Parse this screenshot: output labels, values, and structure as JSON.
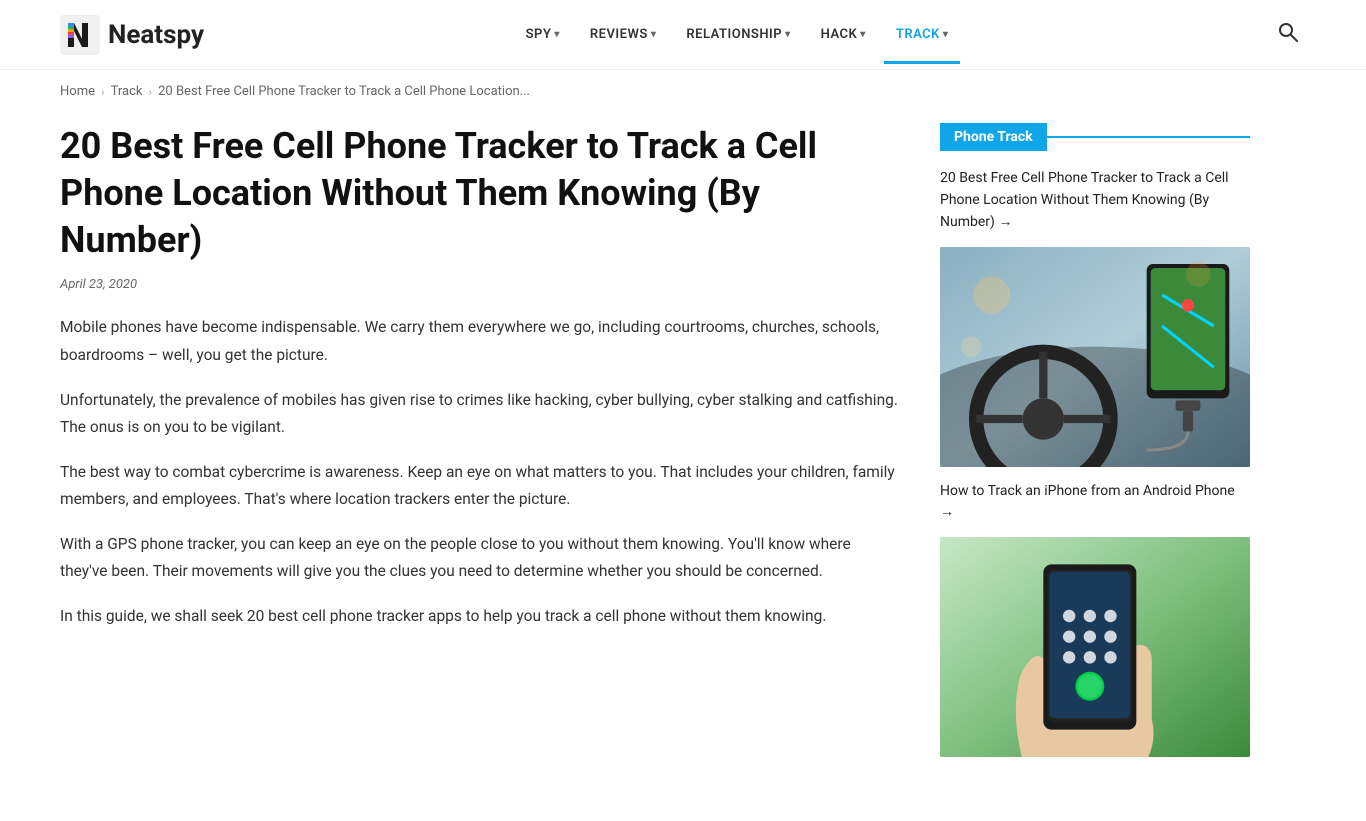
{
  "header": {
    "logo_text": "Neatspy",
    "search_label": "Search"
  },
  "nav": {
    "items": [
      {
        "label": "SPY",
        "has_dropdown": true,
        "active": false
      },
      {
        "label": "REVIEWS",
        "has_dropdown": true,
        "active": false
      },
      {
        "label": "RELATIONSHIP",
        "has_dropdown": true,
        "active": false
      },
      {
        "label": "HACK",
        "has_dropdown": true,
        "active": false
      },
      {
        "label": "TRACK",
        "has_dropdown": true,
        "active": true
      }
    ]
  },
  "breadcrumb": {
    "home": "Home",
    "track": "Track",
    "current": "20 Best Free Cell Phone Tracker to Track a Cell Phone Location..."
  },
  "article": {
    "title": "20 Best Free Cell Phone Tracker to Track a Cell Phone Location Without Them Knowing (By Number)",
    "date": "April 23, 2020",
    "paragraphs": [
      "Mobile phones have become indispensable. We carry them everywhere we go, including courtrooms, churches, schools, boardrooms – well, you get the picture.",
      "Unfortunately, the prevalence of mobiles has given rise to crimes like hacking, cyber bullying, cyber stalking and catfishing. The onus is on you to be vigilant.",
      "The best way to combat cybercrime is awareness. Keep an eye on what matters to you. That includes your children, family members, and employees. That's where location trackers enter the picture.",
      "With a GPS phone tracker, you can keep an eye on the people close to you without them knowing. You'll know where they've been. Their movements will give you the clues you need to determine whether you should be concerned.",
      "In this guide, we shall seek 20 best cell phone tracker apps to help you track a cell phone without them knowing."
    ]
  },
  "sidebar": {
    "widget_title": "Phone Track",
    "link1_text": "20 Best Free Cell Phone Tracker to Track a Cell Phone Location Without Them Knowing (By Number) →",
    "link2_text": "How to Track an iPhone from an Android Phone →"
  }
}
